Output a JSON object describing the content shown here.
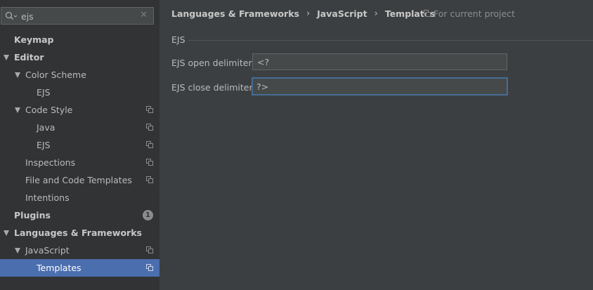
{
  "search": {
    "value": "ejs",
    "placeholder": ""
  },
  "sidebar": {
    "items": [
      {
        "label": "Keymap"
      },
      {
        "label": "Editor"
      },
      {
        "label": "Color Scheme"
      },
      {
        "label": "EJS"
      },
      {
        "label": "Code Style"
      },
      {
        "label": "Java"
      },
      {
        "label": "EJS"
      },
      {
        "label": "Inspections"
      },
      {
        "label": "File and Code Templates"
      },
      {
        "label": "Intentions"
      },
      {
        "label": "Plugins",
        "badge": "1"
      },
      {
        "label": "Languages & Frameworks"
      },
      {
        "label": "JavaScript"
      },
      {
        "label": "Templates"
      }
    ]
  },
  "breadcrumb": [
    "Languages & Frameworks",
    "JavaScript",
    "Templates"
  ],
  "breadcrumb_sep": "›",
  "project_scope": "For current project",
  "section": {
    "title": "EJS"
  },
  "fields": {
    "open": {
      "label": "EJS open delimiter:",
      "value": "<?"
    },
    "close": {
      "label": "EJS close delimiter:",
      "value": "?>"
    }
  },
  "colors": {
    "selection": "#4b6eaf",
    "focus_border": "#466d94",
    "sidebar_bg": "#313335",
    "panel_bg": "#3c3f41"
  },
  "icons": {
    "search": "search-icon",
    "clear": "clear-icon",
    "copy": "copy-icon"
  }
}
